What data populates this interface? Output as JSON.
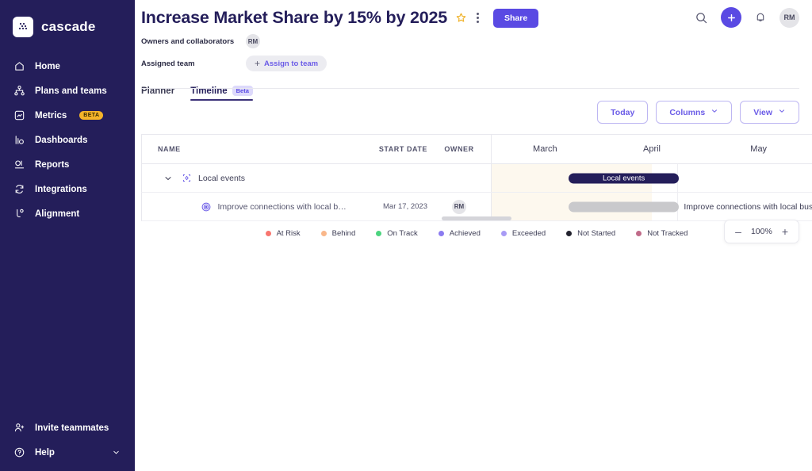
{
  "sidebar": {
    "brand": "cascade",
    "items": [
      {
        "label": "Home",
        "icon": "home-icon"
      },
      {
        "label": "Plans and teams",
        "icon": "plans-teams-icon"
      },
      {
        "label": "Metrics",
        "icon": "metrics-icon",
        "badge": "BETA"
      },
      {
        "label": "Dashboards",
        "icon": "dashboards-icon"
      },
      {
        "label": "Reports",
        "icon": "reports-icon"
      },
      {
        "label": "Integrations",
        "icon": "integrations-icon"
      },
      {
        "label": "Alignment",
        "icon": "alignment-icon"
      }
    ],
    "bottom": [
      {
        "label": "Invite teammates",
        "icon": "invite-user-icon"
      },
      {
        "label": "Help",
        "icon": "help-circle-icon"
      }
    ]
  },
  "header": {
    "title": "Increase Market Share by 15% by 2025",
    "share_label": "Share",
    "owners_label": "Owners and collaborators",
    "owner_initials": "RM",
    "assigned_team_label": "Assigned team",
    "assign_to_team_label": "Assign to team",
    "assign_plus": "+",
    "account_initials": "RM"
  },
  "tabs": [
    {
      "label": "Planner",
      "active": false
    },
    {
      "label": "Timeline",
      "active": true,
      "badge": "Beta"
    }
  ],
  "toolbar": {
    "today_label": "Today",
    "columns_label": "Columns",
    "view_label": "View"
  },
  "table": {
    "columns": [
      "NAME",
      "START DATE",
      "OWNER"
    ],
    "rows": [
      {
        "type": "parent",
        "name": "Local events",
        "start_date": "",
        "owner": "",
        "icon": "objective-icon",
        "bar": {
          "label": "Local events",
          "left_pct": 22,
          "width_pct": 33,
          "color": "#241e5a"
        }
      },
      {
        "type": "child",
        "name": "Improve connections with local businesses an...",
        "start_date": "Mar 17, 2023",
        "owner": "RM",
        "icon": "target-icon",
        "bar": {
          "label": "",
          "left_pct": 22,
          "width_pct": 33,
          "color": "#c9c9cc"
        },
        "bar_caption": "Improve connections with local busine"
      }
    ]
  },
  "timeline": {
    "months": [
      "March",
      "April",
      "May"
    ]
  },
  "legend": [
    {
      "label": "At Risk",
      "color": "#f8766f"
    },
    {
      "label": "Behind",
      "color": "#f9b78a"
    },
    {
      "label": "On Track",
      "color": "#4cd47f"
    },
    {
      "label": "Achieved",
      "color": "#8b7bf0"
    },
    {
      "label": "Exceeded",
      "color": "#a89bf5"
    },
    {
      "label": "Not Started",
      "color": "#22222e"
    },
    {
      "label": "Not Tracked",
      "color": "#c06b89"
    }
  ],
  "zoom_control": {
    "minus": "–",
    "value": "100%",
    "plus": "+"
  },
  "colors": {
    "sidebar_bg": "#241e5a",
    "accent": "#5a4ae3",
    "accent_light": "#6b5ce7",
    "badge_beta": "#f5b429",
    "track_tint": "#fdf8ee"
  }
}
